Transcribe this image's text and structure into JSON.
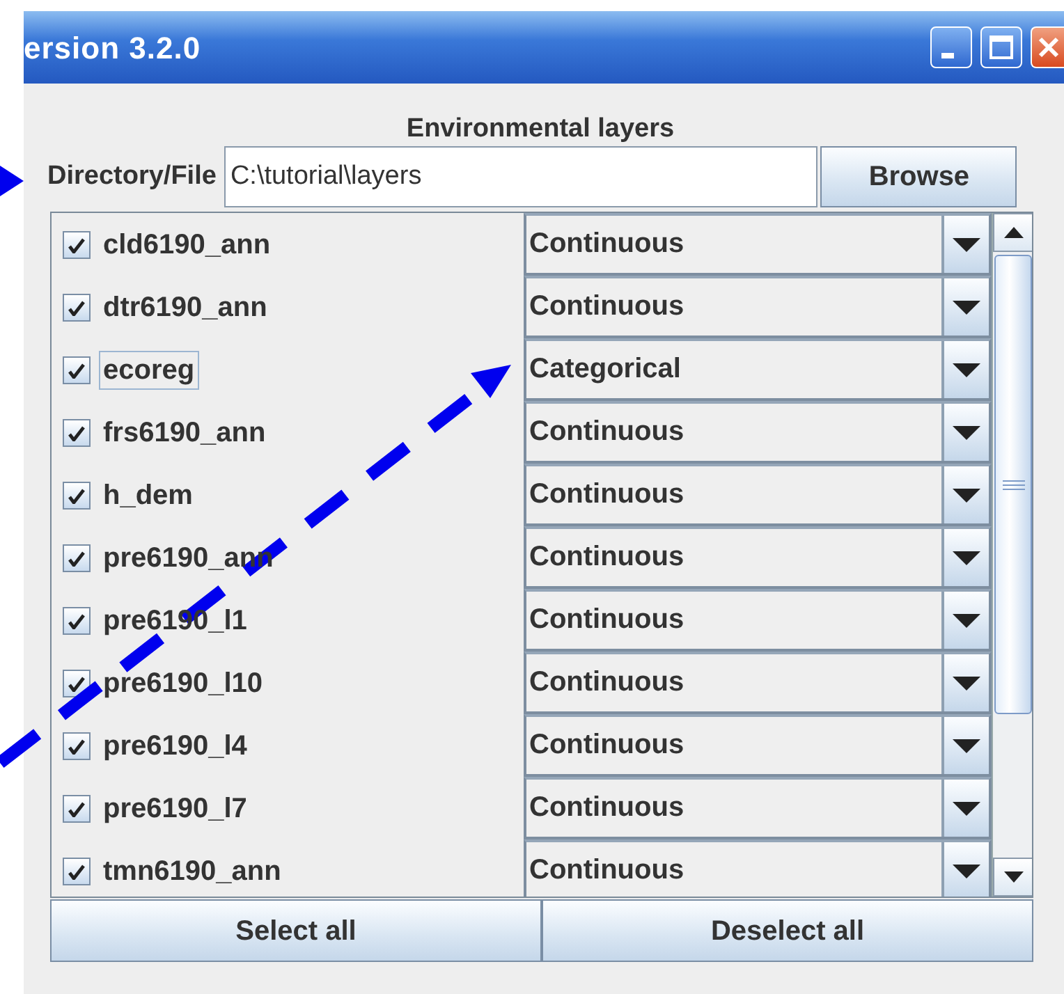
{
  "window": {
    "title": "ersion 3.2.0",
    "buttons": [
      {
        "kind": "minimize"
      },
      {
        "kind": "maximize"
      },
      {
        "kind": "close"
      }
    ]
  },
  "heading": "Environmental layers",
  "directory": {
    "label": "Directory/File",
    "value": "C:\\tutorial\\layers",
    "button": "Browse"
  },
  "layers": [
    {
      "name": "cld6190_ann",
      "checked": true,
      "focused": false,
      "type": "Continuous"
    },
    {
      "name": "dtr6190_ann",
      "checked": true,
      "focused": false,
      "type": "Continuous"
    },
    {
      "name": "ecoreg",
      "checked": true,
      "focused": true,
      "type": "Categorical"
    },
    {
      "name": "frs6190_ann",
      "checked": true,
      "focused": false,
      "type": "Continuous"
    },
    {
      "name": "h_dem",
      "checked": true,
      "focused": false,
      "type": "Continuous"
    },
    {
      "name": "pre6190_ann",
      "checked": true,
      "focused": false,
      "type": "Continuous"
    },
    {
      "name": "pre6190_l1",
      "checked": true,
      "focused": false,
      "type": "Continuous"
    },
    {
      "name": "pre6190_l10",
      "checked": true,
      "focused": false,
      "type": "Continuous"
    },
    {
      "name": "pre6190_l4",
      "checked": true,
      "focused": false,
      "type": "Continuous"
    },
    {
      "name": "pre6190_l7",
      "checked": true,
      "focused": false,
      "type": "Continuous"
    },
    {
      "name": "tmn6190_ann",
      "checked": true,
      "focused": false,
      "type": "Continuous"
    }
  ],
  "buttons": [
    "Select all",
    "Deselect all"
  ]
}
